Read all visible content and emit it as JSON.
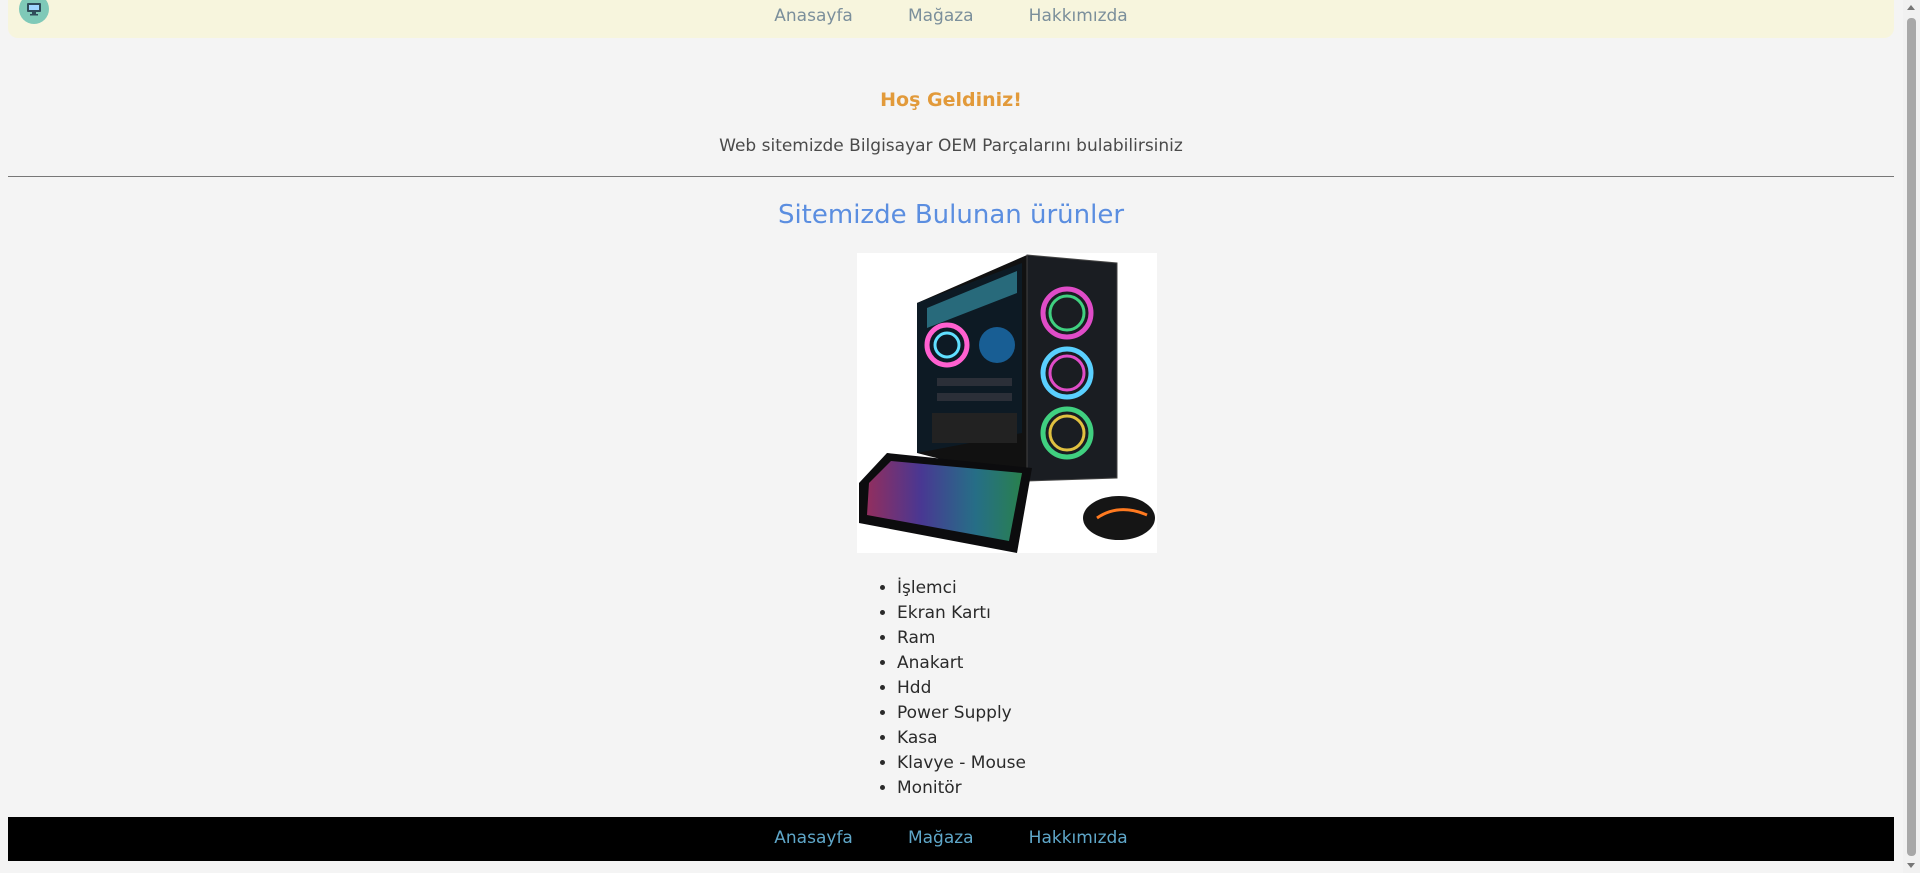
{
  "nav": {
    "logo_icon": "monitor-icon",
    "links": [
      "Anasayfa",
      "Mağaza",
      "Hakkımızda"
    ]
  },
  "welcome": {
    "title": "Hoş Geldiniz!",
    "subtitle": "Web sitemizde Bilgisayar OEM Parçalarını bulabilirsiniz"
  },
  "products": {
    "heading": "Sitemizde Bulunan ürünler",
    "image_icon": "gaming-pc-icon",
    "items": [
      "İşlemci",
      "Ekran Kartı",
      "Ram",
      "Anakart",
      "Hdd",
      "Power Supply",
      "Kasa",
      "Klavye - Mouse",
      "Monitör"
    ]
  },
  "footer": {
    "links": [
      "Anasayfa",
      "Mağaza",
      "Hakkımızda"
    ]
  },
  "colors": {
    "nav_bg": "#f7f5dd",
    "welcome": "#e29a3a",
    "heading": "#5b8ee0",
    "footer_bg": "#000000",
    "footer_link": "#5fa7c9"
  }
}
